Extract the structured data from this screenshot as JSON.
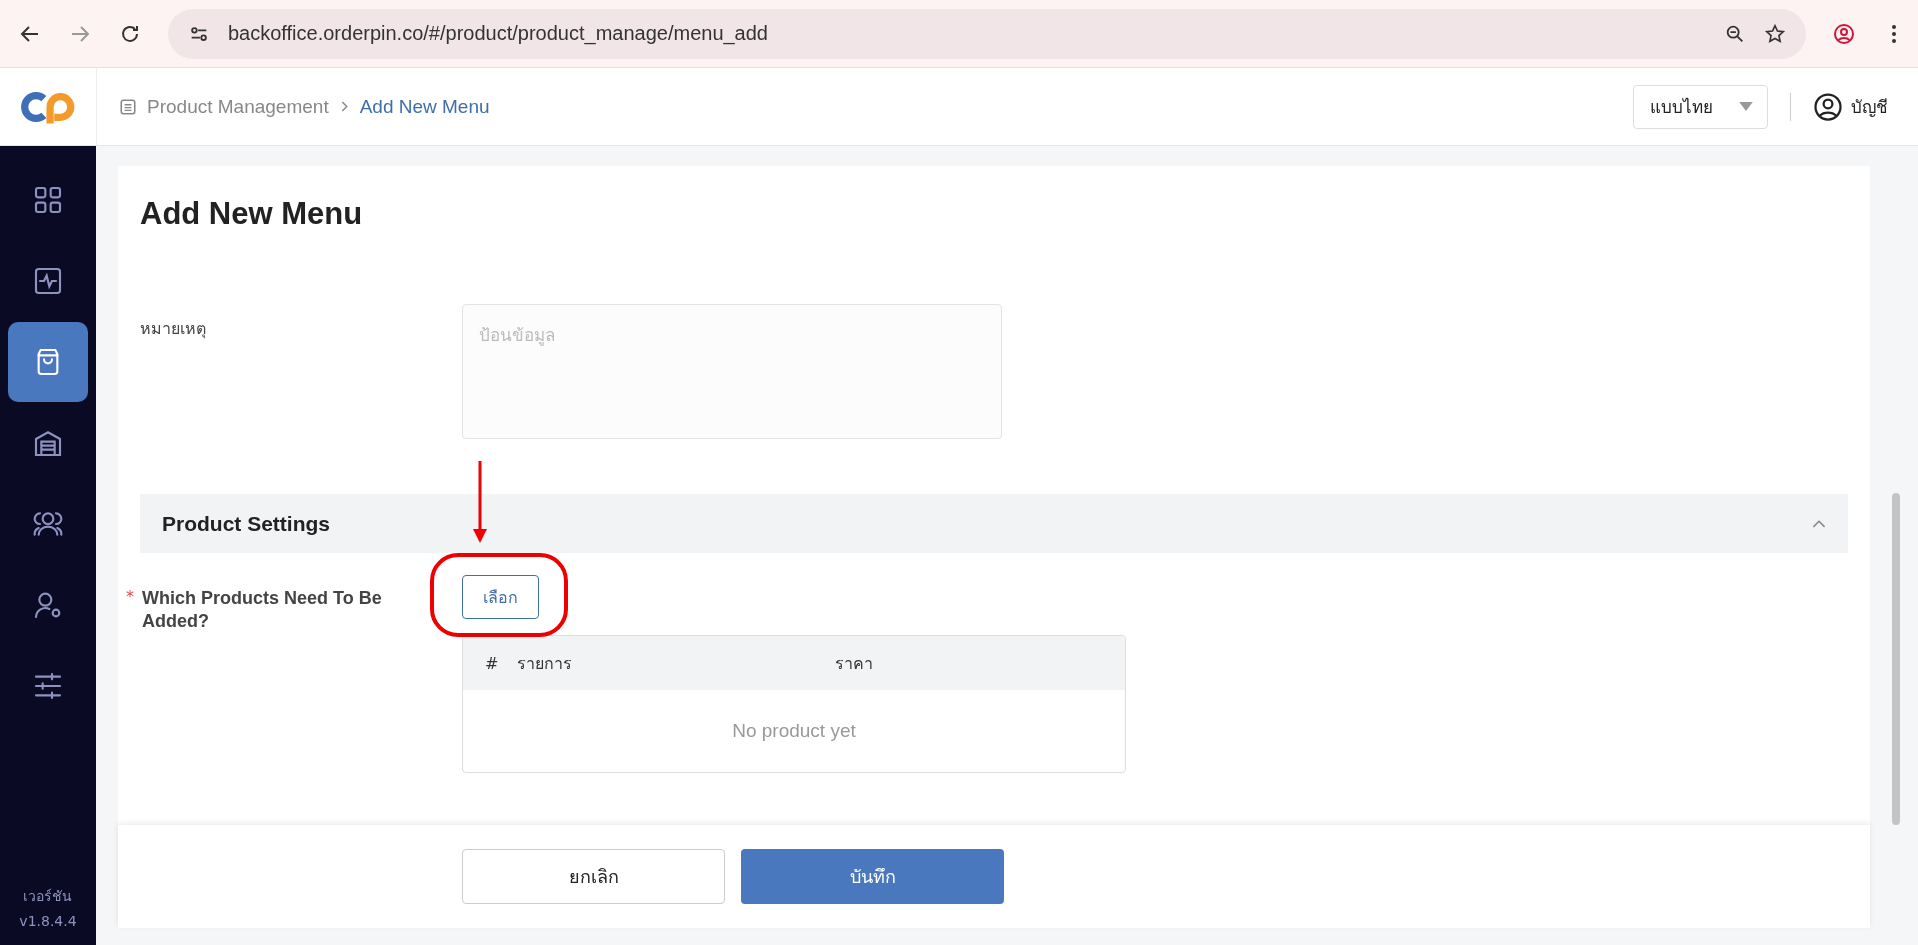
{
  "browser": {
    "url": "backoffice.orderpin.co/#/product/product_manage/menu_add"
  },
  "breadcrumb": [
    {
      "label": "Product Management",
      "selected": false
    },
    {
      "label": "Add New Menu",
      "selected": true
    }
  ],
  "language_select": {
    "value": "แบบไทย"
  },
  "account": {
    "label": "บัญชี"
  },
  "sidebar": {
    "items": [
      {
        "selected": false
      },
      {
        "selected": false
      },
      {
        "selected": true
      },
      {
        "selected": false
      },
      {
        "selected": false
      },
      {
        "selected": false
      },
      {
        "selected": false
      }
    ],
    "version_label": "เวอร์ชัน",
    "version": "v1.8.4.4"
  },
  "page": {
    "title": "Add New Menu",
    "note": {
      "label": "หมายเหตุ",
      "placeholder": "ป้อนข้อมูล"
    },
    "section": {
      "title": "Product Settings",
      "expanded": true
    },
    "products": {
      "label": "Which Products Need To Be Added?",
      "required_mark": "*",
      "button": "เลือก",
      "columns": [
        "#",
        "รายการ",
        "ราคา"
      ],
      "empty": "No product yet"
    }
  },
  "footer": {
    "cancel": "ยกเลิก",
    "save": "บันทึก"
  }
}
